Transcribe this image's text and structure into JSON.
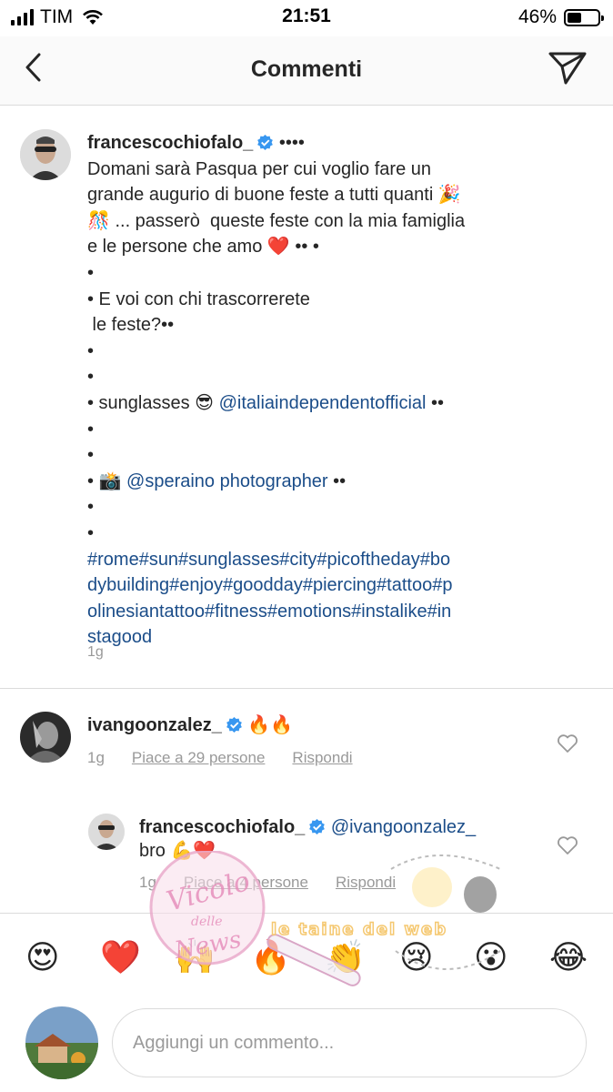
{
  "status_bar": {
    "carrier": "TIM",
    "time": "21:51",
    "battery": "46%",
    "battery_level": 0.46
  },
  "header": {
    "title": "Commenti",
    "back_icon": "chevron-left-icon",
    "send_icon": "paper-plane-icon"
  },
  "caption": {
    "username": "francescochiofalo_",
    "after_name": " ••••",
    "lines": [
      "Domani sarà Pasqua per cui voglio fare un",
      "grande augurio di buone feste a tutti quanti 🎉",
      "🎊 ... passerò  queste feste con la mia famiglia",
      "e le persone che amo ❤️ •• •",
      "•",
      "• E voi con chi trascorrerete",
      " le feste?••",
      "•",
      "•"
    ],
    "sunglasses_prefix": "• sunglasses 😎 ",
    "sunglasses_mention": "@italiaindependentofficial",
    "sunglasses_suffix": " ••",
    "lines2": [
      "•",
      "•"
    ],
    "camera_prefix": "• 📸 ",
    "camera_mention": "@speraino photographer",
    "camera_suffix": " ••",
    "lines3": [
      "•",
      "•"
    ],
    "hashtags": [
      "#rome#sun#sunglasses#city#picoftheday#bo",
      "dybuilding#enjoy#goodday#piercing#tattoo#p",
      "olinesiantattoo#fitness#emotions#instalike#in",
      "stagood"
    ],
    "time": "1g"
  },
  "comments": [
    {
      "username": "ivangoonzalez_",
      "text": " 🔥🔥",
      "time": "1g",
      "likes": "Piace a 29 persone",
      "reply": "Rispondi"
    },
    {
      "username": "francescochiofalo_",
      "mention": "@ivangoonzalez_",
      "text": "bro 💪❤️",
      "time": "1g",
      "likes": "Piace a 4 persone",
      "reply": "Rispondi"
    }
  ],
  "emoji_bar": [
    "😍",
    "❤️",
    "🙌",
    "🔥",
    "👏",
    "😢",
    "😮",
    "😂"
  ],
  "input": {
    "placeholder": "Aggiungi un commento..."
  },
  "watermark": {
    "text1": "Vicolo",
    "text2": "delle",
    "text3": "News",
    "text4": "le taine del web"
  },
  "colors": {
    "link": "#1b4d89",
    "verified": "#3897f0",
    "secondary": "#999999",
    "divider": "#dbdbdb"
  }
}
